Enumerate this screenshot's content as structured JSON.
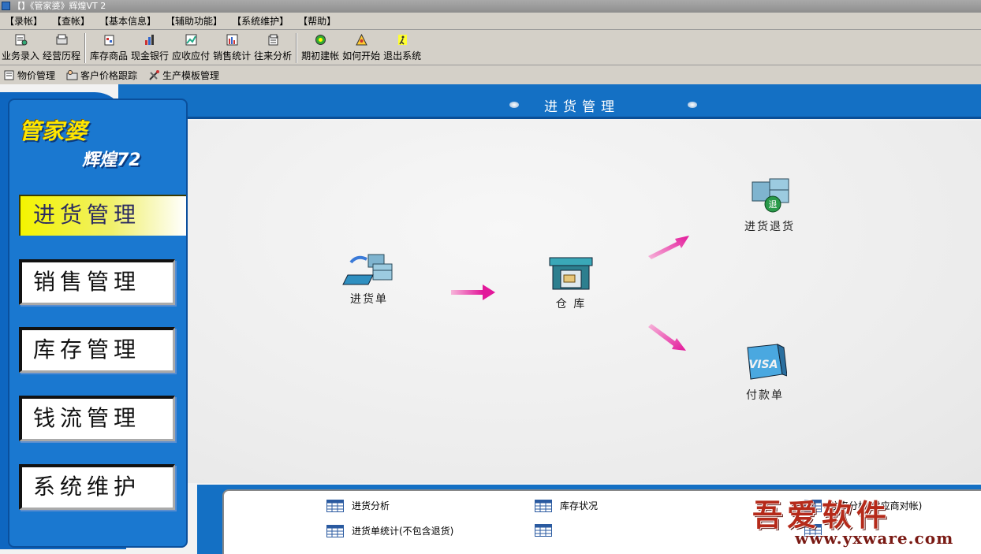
{
  "window": {
    "title": "【】《管家婆》辉煌VT 2"
  },
  "menu": [
    {
      "label": "【录帐】"
    },
    {
      "label": "【查帐】"
    },
    {
      "label": "【基本信息】"
    },
    {
      "label": "【辅助功能】"
    },
    {
      "label": "【系统维护】"
    },
    {
      "label": "【帮助】"
    }
  ],
  "toolbar": {
    "groups": [
      [
        {
          "label": "业务录入",
          "icon": "entry-icon"
        },
        {
          "label": "经营历程",
          "icon": "history-icon"
        }
      ],
      [
        {
          "label": "库存商品",
          "icon": "stock-icon"
        },
        {
          "label": "现金银行",
          "icon": "cash-icon"
        },
        {
          "label": "应收应付",
          "icon": "receivable-icon"
        },
        {
          "label": "销售统计",
          "icon": "sales-stats-icon"
        },
        {
          "label": "往来分析",
          "icon": "analysis-icon"
        }
      ],
      [
        {
          "label": "期初建帐",
          "icon": "initial-icon"
        },
        {
          "label": "如何开始",
          "icon": "howto-icon"
        },
        {
          "label": "退出系统",
          "icon": "exit-icon"
        }
      ]
    ]
  },
  "subbar": [
    {
      "label": "物价管理",
      "icon": "price-icon"
    },
    {
      "label": "客户价格跟踪",
      "icon": "client-price-icon"
    },
    {
      "label": "生产模板管理",
      "icon": "template-icon"
    }
  ],
  "header": {
    "title": "进货管理"
  },
  "logo": {
    "top": "管家婆",
    "bottom": "辉煌72"
  },
  "sidebar": {
    "active": "进货管理",
    "items": [
      {
        "label": "销售管理"
      },
      {
        "label": "库存管理"
      },
      {
        "label": "钱流管理"
      },
      {
        "label": "系统维护"
      }
    ]
  },
  "flow": {
    "purchase_order": "进货单",
    "warehouse": "仓 库",
    "purchase_return": "进货退货",
    "payment": "付款单"
  },
  "reports": {
    "col1": [
      "进货分析",
      "进货单统计(不包含退货)"
    ],
    "col2": [
      "库存状况",
      ""
    ],
    "col3": [
      "往来分析(供应商对帐)",
      ""
    ]
  },
  "watermark": {
    "title": "吾爱软件",
    "url": "www.yxware.com"
  },
  "colors": {
    "accent_blue": "#1470c4",
    "active_tab": "#f4f400",
    "arrow": "#e2189a"
  }
}
